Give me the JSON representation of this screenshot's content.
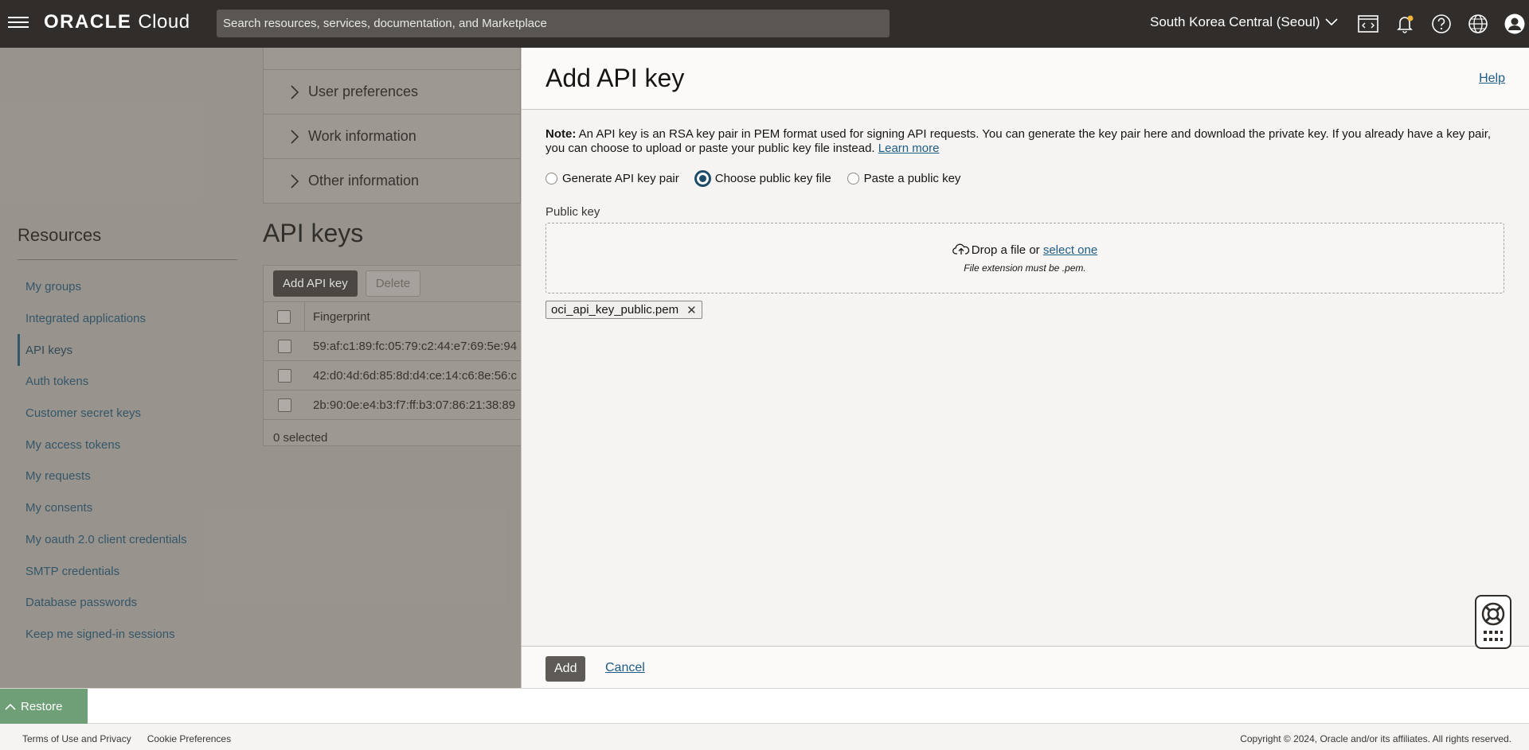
{
  "topbar": {
    "logo_oracle": "ORACLE",
    "logo_cloud": "Cloud",
    "search_placeholder": "Search resources, services, documentation, and Marketplace",
    "region": "South Korea Central (Seoul)"
  },
  "background": {
    "accordion": [
      "User preferences",
      "Work information",
      "Other information"
    ],
    "resources_title": "Resources",
    "resources": [
      {
        "label": "My groups",
        "active": false
      },
      {
        "label": "Integrated applications",
        "active": false
      },
      {
        "label": "API keys",
        "active": true
      },
      {
        "label": "Auth tokens",
        "active": false
      },
      {
        "label": "Customer secret keys",
        "active": false
      },
      {
        "label": "My access tokens",
        "active": false
      },
      {
        "label": "My requests",
        "active": false
      },
      {
        "label": "My consents",
        "active": false
      },
      {
        "label": "My oauth 2.0 client credentials",
        "active": false
      },
      {
        "label": "SMTP credentials",
        "active": false
      },
      {
        "label": "Database passwords",
        "active": false
      },
      {
        "label": "Keep me signed-in sessions",
        "active": false
      }
    ],
    "api_keys_title": "API keys",
    "add_api_key_label": "Add API key",
    "delete_label": "Delete",
    "fingerprint_header": "Fingerprint",
    "fingerprints": [
      "59:af:c1:89:fc:05:79:c2:44:e7:69:5e:94",
      "42:d0:4d:6d:85:8d:d4:ce:14:c6:8e:56:c",
      "2b:90:0e:e4:b3:f7:ff:b3:07:86:21:38:89"
    ],
    "selected_count": "0 selected"
  },
  "panel": {
    "title": "Add API key",
    "help": "Help",
    "note_bold": "Note:",
    "note_text": " An API key is an RSA key pair in PEM format used for signing API requests. You can generate the key pair here and download the private key. If you already have a key pair, you can choose to upload or paste your public key file instead. ",
    "learn_more": "Learn more",
    "radio_options": [
      {
        "label": "Generate API key pair",
        "checked": false
      },
      {
        "label": "Choose public key file",
        "checked": true
      },
      {
        "label": "Paste a public key",
        "checked": false
      }
    ],
    "public_key_label": "Public key",
    "drop_text": "Drop a file or ",
    "select_one": "select one",
    "file_ext_note": "File extension must be .pem.",
    "file_name": "oci_api_key_public.pem",
    "add_label": "Add",
    "cancel_label": "Cancel"
  },
  "restore_label": "Restore",
  "footer": {
    "terms": "Terms of Use and Privacy",
    "cookies": "Cookie Preferences",
    "copyright": "Copyright © 2024, Oracle and/or its affiliates. All rights reserved."
  }
}
